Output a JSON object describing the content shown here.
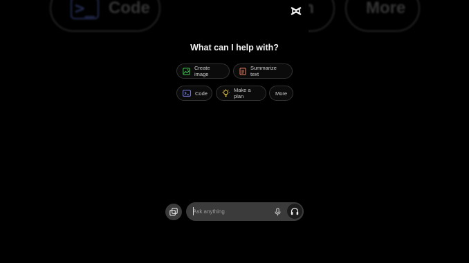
{
  "background": {
    "pills": [
      {
        "label": "Code",
        "icon": "code-icon"
      },
      {
        "label": "More"
      }
    ],
    "partial_text": "n"
  },
  "logo": {
    "icon": "capcut-logo-icon"
  },
  "headline": "What can I help with?",
  "chips": [
    {
      "label": "Create image",
      "icon": "image-icon",
      "color": "#3fb950"
    },
    {
      "label": "Summarize text",
      "icon": "document-icon",
      "color": "#e07a5f"
    },
    {
      "label": "Code",
      "icon": "code-icon",
      "color": "#7b7fe8"
    },
    {
      "label": "Make a plan",
      "icon": "lightbulb-icon",
      "color": "#e6c84a"
    },
    {
      "label": "More"
    }
  ],
  "input": {
    "placeholder": "Ask anything",
    "mic_icon": "microphone-icon",
    "voice_icon": "headphones-icon",
    "apps_icon": "apps-icon"
  }
}
